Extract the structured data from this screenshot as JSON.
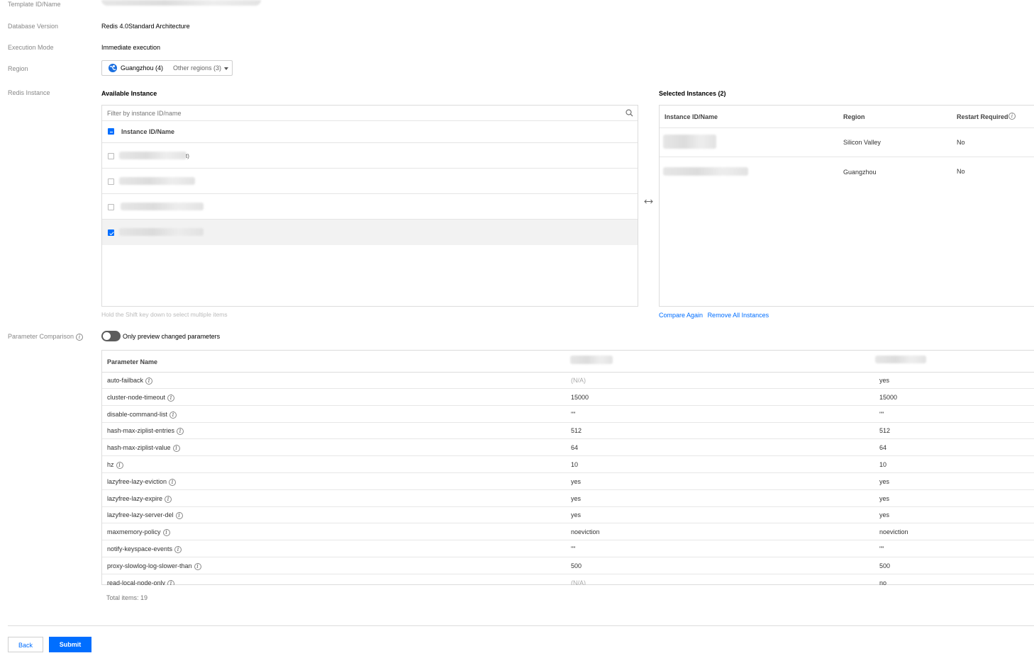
{
  "form": {
    "template_label": "Template ID/Name",
    "db_version_label": "Database Version",
    "db_version_value": "Redis 4.0Standard Architecture",
    "exec_mode_label": "Execution Mode",
    "exec_mode_value": "Immediate execution",
    "region_label": "Region",
    "region_primary": "Guangzhou (4)",
    "region_other": "Other regions (3)",
    "redis_instance_label": "Redis Instance",
    "param_compare_label": "Parameter Comparison"
  },
  "available": {
    "title": "Available Instance",
    "filter_placeholder": "Filter by instance ID/name",
    "column_header": "Instance ID/Name",
    "rows": [
      {
        "checked": false,
        "suffix": "t)"
      },
      {
        "checked": false,
        "suffix": ""
      },
      {
        "checked": false,
        "suffix": ""
      },
      {
        "checked": true,
        "suffix": ""
      }
    ],
    "hint": "Hold the Shift key down to select multiple items"
  },
  "selected": {
    "title": "Selected Instances (2)",
    "col_id": "Instance ID/Name",
    "col_region": "Region",
    "col_restart": "Restart Required",
    "rows": [
      {
        "region": "Silicon Valley",
        "restart": "No"
      },
      {
        "region": "Guangzhou",
        "restart": "No"
      }
    ],
    "compare_again": "Compare Again",
    "remove_all": "Remove All Instances"
  },
  "comparison": {
    "toggle_label": "Only preview changed parameters",
    "toggle_on": false,
    "col_param": "Parameter Name",
    "rows": [
      {
        "name": "auto-failback",
        "a": "(N/A)",
        "b": "yes"
      },
      {
        "name": "cluster-node-timeout",
        "a": "15000",
        "b": "15000"
      },
      {
        "name": "disable-command-list",
        "a": "\"\"",
        "b": "\"\""
      },
      {
        "name": "hash-max-ziplist-entries",
        "a": "512",
        "b": "512"
      },
      {
        "name": "hash-max-ziplist-value",
        "a": "64",
        "b": "64"
      },
      {
        "name": "hz",
        "a": "10",
        "b": "10"
      },
      {
        "name": "lazyfree-lazy-eviction",
        "a": "yes",
        "b": "yes"
      },
      {
        "name": "lazyfree-lazy-expire",
        "a": "yes",
        "b": "yes"
      },
      {
        "name": "lazyfree-lazy-server-del",
        "a": "yes",
        "b": "yes"
      },
      {
        "name": "maxmemory-policy",
        "a": "noeviction",
        "b": "noeviction"
      },
      {
        "name": "notify-keyspace-events",
        "a": "\"\"",
        "b": "\"\""
      },
      {
        "name": "proxy-slowlog-log-slower-than",
        "a": "500",
        "b": "500"
      },
      {
        "name": "read-local-node-only",
        "a": "(N/A)",
        "b": "no"
      }
    ],
    "total_label": "Total items:",
    "total_value": "19"
  },
  "footer": {
    "back_label": "Back",
    "submit_label": "Submit"
  },
  "colors": {
    "accent": "#006eff",
    "label_gray": "#888888"
  },
  "icons": [
    "globe-icon",
    "caret-down-icon",
    "search-icon",
    "swap-arrows-icon",
    "info-icon",
    "checkbox-icon"
  ]
}
